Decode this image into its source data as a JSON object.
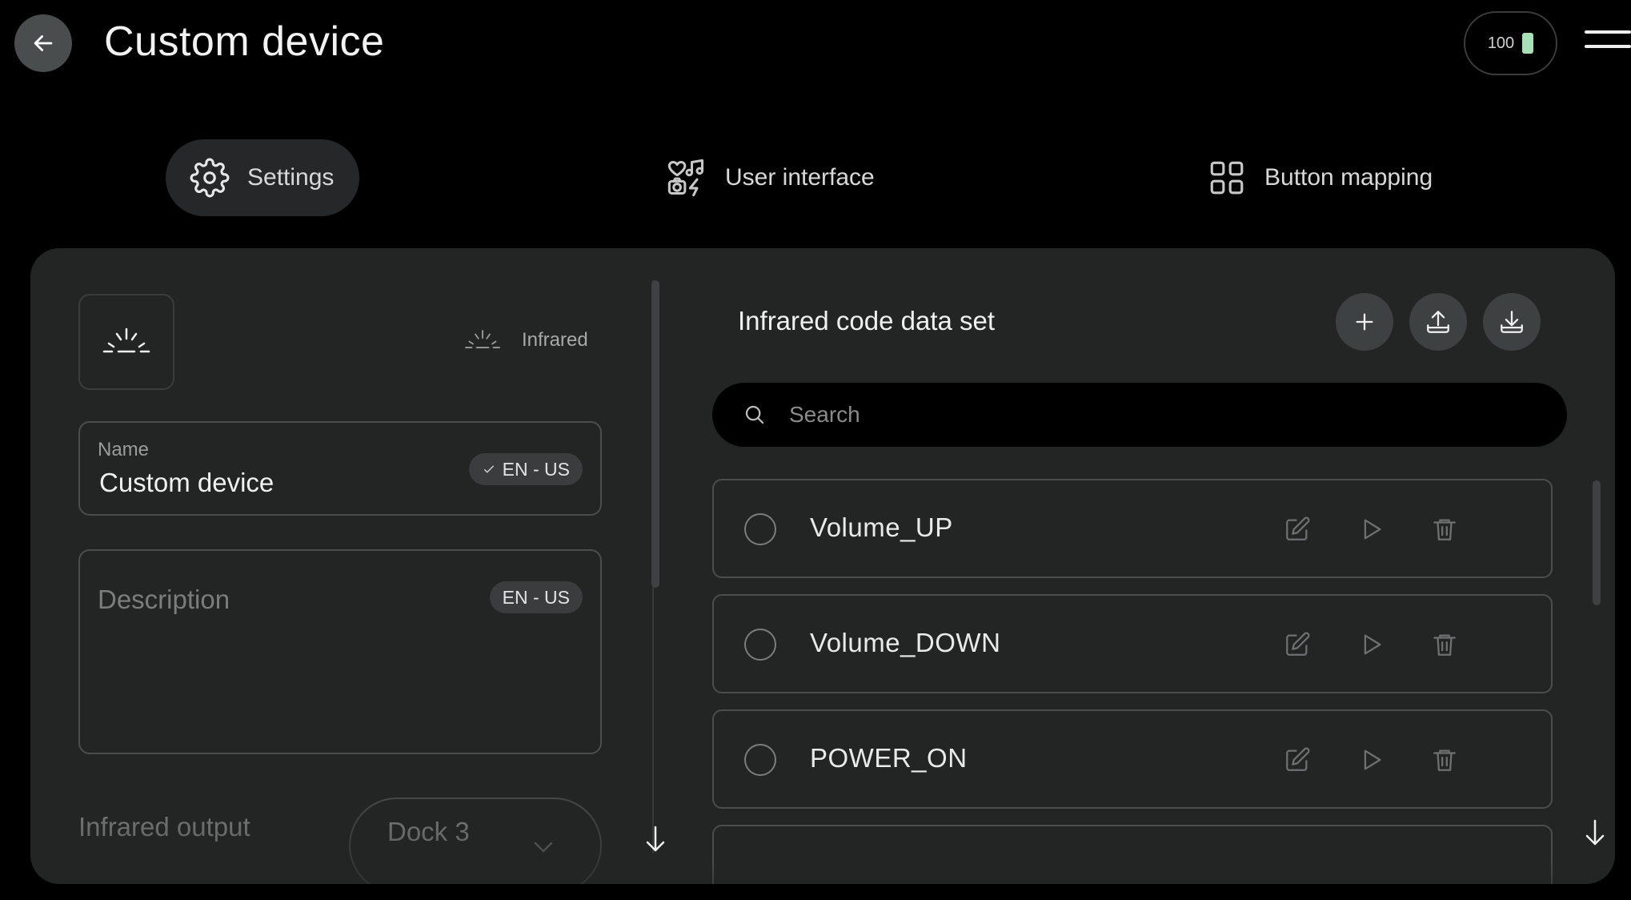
{
  "header": {
    "title": "Custom device",
    "battery_level": "100"
  },
  "tabs": [
    {
      "label": "Settings",
      "icon": "gear-icon",
      "active": true
    },
    {
      "label": "User interface",
      "icon": "ui-icons-icon",
      "active": false
    },
    {
      "label": "Button mapping",
      "icon": "grid-icon",
      "active": false
    }
  ],
  "device": {
    "type_label": "Infrared",
    "name_label": "Name",
    "name_value": "Custom device",
    "name_lang": "EN - US",
    "description_placeholder": "Description",
    "description_lang": "EN - US",
    "ir_output_label": "Infrared output",
    "ir_output_value": "Dock 3"
  },
  "dataset": {
    "title": "Infrared code data set",
    "search_placeholder": "Search",
    "codes": [
      {
        "name": "Volume_UP"
      },
      {
        "name": "Volume_DOWN"
      },
      {
        "name": "POWER_ON"
      },
      {
        "name": ""
      }
    ]
  },
  "colors": {
    "background": "#000000",
    "panel": "#232525",
    "battery_fill": "#a8e0b8"
  }
}
